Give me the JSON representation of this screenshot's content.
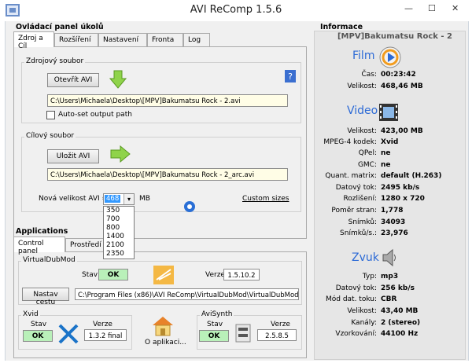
{
  "window": {
    "title": "AVI ReComp  1.5.6",
    "min": "—",
    "max": "☐",
    "close": "✕"
  },
  "tasks": {
    "title": "Ovládací panel úkolů",
    "tabs": [
      "Zdroj a Cíl",
      "Rozšíření",
      "Nastavení",
      "Fronta",
      "Log"
    ],
    "source": {
      "label": "Zdrojový soubor",
      "open_button": "Otevřít AVI",
      "path": "C:\\Users\\Michaela\\Desktop\\[MPV]Bakumatsu Rock - 2.avi",
      "autoset_label": "Auto-set output path"
    },
    "target": {
      "label": "Cílový soubor",
      "save_button": "Uložit AVI",
      "path": "C:\\Users\\Michaela\\Desktop\\[MPV]Bakumatsu Rock - 2_arc.avi"
    },
    "size": {
      "label": "Nová velikost AVI =",
      "value": "468",
      "unit": "MB",
      "custom_link": "Custom sizes",
      "options": [
        "350",
        "700",
        "800",
        "1400",
        "2100",
        "2350"
      ]
    }
  },
  "applications": {
    "title": "Applications",
    "tabs": [
      "Control panel",
      "Prostředí"
    ],
    "vdm": {
      "label": "VirtualDubMod",
      "state_label": "Stav",
      "state": "OK",
      "version_label": "Verze",
      "version": "1.5.10.2",
      "path_button": "Nastav cestu",
      "path": "C:\\Program Files (x86)\\AVI ReComp\\VirtualDubMod\\VirtualDubMod.exe"
    },
    "xvid": {
      "label": "Xvid",
      "state_label": "Stav",
      "state": "OK",
      "version_label": "Verze",
      "version": "1.3.2 final"
    },
    "about": "O aplikaci...",
    "avisynth": {
      "label": "AviSynth",
      "state_label": "Stav",
      "state": "OK",
      "version_label": "Verze",
      "version": "2.5.8.5"
    }
  },
  "info": {
    "title": "Informace",
    "filename": "[MPV]Bakumatsu Rock - 2",
    "film": {
      "heading": "Film",
      "rows": [
        {
          "label": "Čas:",
          "value": "00:23:42"
        },
        {
          "label": "Velikost:",
          "value": "468,46 MB"
        }
      ]
    },
    "video": {
      "heading": "Video",
      "rows": [
        {
          "label": "Velikost:",
          "value": "423,00 MB"
        },
        {
          "label": "MPEG-4 kodek:",
          "value": "Xvid"
        },
        {
          "label": "QPel:",
          "value": "ne"
        },
        {
          "label": "GMC:",
          "value": "ne"
        },
        {
          "label": "Quant. matrix:",
          "value": "default (H.263)"
        },
        {
          "label": "Datový tok:",
          "value": "2495 kb/s"
        },
        {
          "label": "Rozlišení:",
          "value": "1280 x 720"
        },
        {
          "label": "Poměr stran:",
          "value": "1,778"
        },
        {
          "label": "Snímků:",
          "value": "34093"
        },
        {
          "label": "Snímků/s.:",
          "value": "23,976"
        }
      ]
    },
    "audio": {
      "heading": "Zvuk",
      "rows": [
        {
          "label": "Typ:",
          "value": "mp3"
        },
        {
          "label": "Datový tok:",
          "value": "256 kb/s"
        },
        {
          "label": "Mód dat. toku:",
          "value": "CBR"
        },
        {
          "label": "Velikost:",
          "value": "43,40 MB"
        },
        {
          "label": "Kanály:",
          "value": "2 (stereo)"
        },
        {
          "label": "Vzorkování:",
          "value": "44100 Hz"
        }
      ]
    }
  }
}
